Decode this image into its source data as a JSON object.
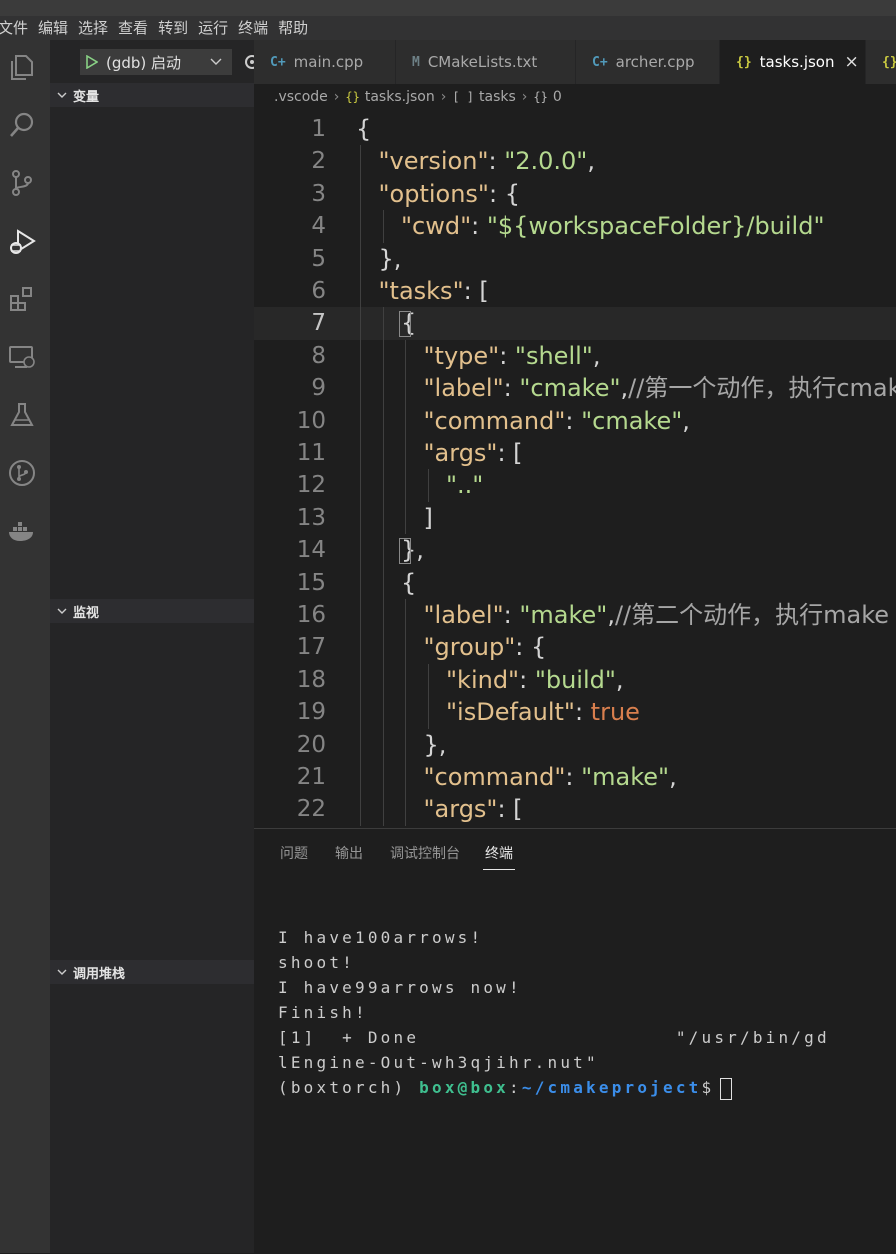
{
  "menu": [
    "文件",
    "编辑",
    "选择",
    "查看",
    "转到",
    "运行",
    "终端",
    "帮助"
  ],
  "activity_icons": [
    "files-icon",
    "search-icon",
    "source-control-icon",
    "run-debug-icon",
    "extensions-icon",
    "remote-explorer-icon",
    "testing-icon",
    "git-graph-icon",
    "docker-icon"
  ],
  "debug": {
    "launch_config": "(gdb) 启动"
  },
  "sidebar": {
    "sections": [
      {
        "title": "变量"
      },
      {
        "title": "监视"
      },
      {
        "title": "调用堆栈"
      }
    ]
  },
  "tabs": [
    {
      "icon": "C+",
      "label": "main.cpp",
      "color": "#519aba"
    },
    {
      "icon": "M",
      "label": "CMakeLists.txt",
      "color": "#6d8086"
    },
    {
      "icon": "C+",
      "label": "archer.cpp",
      "color": "#519aba"
    },
    {
      "icon": "{}",
      "label": "tasks.json",
      "color": "#cbcb41",
      "active": true,
      "close": "×"
    },
    {
      "icon": "{}",
      "label": "",
      "color": "#cbcb41"
    }
  ],
  "breadcrumb": {
    "folder": ".vscode",
    "file": "tasks.json",
    "node1": "tasks",
    "node2": "0",
    "icon_json": "{}",
    "icon_array": "[ ]",
    "icon_obj": "{}"
  },
  "editor": {
    "current_line": 7,
    "lines": [
      {
        "n": "1",
        "indent": 0,
        "tokens": [
          [
            "p",
            "{"
          ]
        ]
      },
      {
        "n": "2",
        "indent": 1,
        "tokens": [
          [
            "k",
            "\"version\""
          ],
          [
            "p",
            ": "
          ],
          [
            "s",
            "\"2.0.0\""
          ],
          [
            "p",
            ","
          ]
        ]
      },
      {
        "n": "3",
        "indent": 1,
        "tokens": [
          [
            "k",
            "\"options\""
          ],
          [
            "p",
            ": {"
          ]
        ]
      },
      {
        "n": "4",
        "indent": 2,
        "tokens": [
          [
            "k",
            "\"cwd\""
          ],
          [
            "p",
            ": "
          ],
          [
            "s",
            "\"${workspaceFolder}/build\""
          ]
        ]
      },
      {
        "n": "5",
        "indent": 1,
        "tokens": [
          [
            "p",
            "},"
          ]
        ]
      },
      {
        "n": "6",
        "indent": 1,
        "tokens": [
          [
            "k",
            "\"tasks\""
          ],
          [
            "p",
            ": ["
          ]
        ]
      },
      {
        "n": "7",
        "indent": 2,
        "tokens": [
          [
            "p",
            "{"
          ]
        ]
      },
      {
        "n": "8",
        "indent": 3,
        "tokens": [
          [
            "k",
            "\"type\""
          ],
          [
            "p",
            ": "
          ],
          [
            "s",
            "\"shell\""
          ],
          [
            "p",
            ","
          ]
        ]
      },
      {
        "n": "9",
        "indent": 3,
        "tokens": [
          [
            "k",
            "\"label\""
          ],
          [
            "p",
            ": "
          ],
          [
            "s",
            "\"cmake\""
          ],
          [
            "p",
            ","
          ],
          [
            "c",
            "//第一个动作，执行cmake"
          ]
        ]
      },
      {
        "n": "10",
        "indent": 3,
        "tokens": [
          [
            "k",
            "\"command\""
          ],
          [
            "p",
            ": "
          ],
          [
            "s",
            "\"cmake\""
          ],
          [
            "p",
            ","
          ]
        ]
      },
      {
        "n": "11",
        "indent": 3,
        "tokens": [
          [
            "k",
            "\"args\""
          ],
          [
            "p",
            ": ["
          ]
        ]
      },
      {
        "n": "12",
        "indent": 4,
        "tokens": [
          [
            "s",
            "\"..\""
          ]
        ]
      },
      {
        "n": "13",
        "indent": 3,
        "tokens": [
          [
            "p",
            "]"
          ]
        ]
      },
      {
        "n": "14",
        "indent": 2,
        "tokens": [
          [
            "p",
            "},"
          ]
        ]
      },
      {
        "n": "15",
        "indent": 2,
        "tokens": [
          [
            "p",
            "{"
          ]
        ]
      },
      {
        "n": "16",
        "indent": 3,
        "tokens": [
          [
            "k",
            "\"label\""
          ],
          [
            "p",
            ": "
          ],
          [
            "s",
            "\"make\""
          ],
          [
            "p",
            ","
          ],
          [
            "c",
            "//第二个动作，执行make"
          ]
        ]
      },
      {
        "n": "17",
        "indent": 3,
        "tokens": [
          [
            "k",
            "\"group\""
          ],
          [
            "p",
            ": {"
          ]
        ]
      },
      {
        "n": "18",
        "indent": 4,
        "tokens": [
          [
            "k",
            "\"kind\""
          ],
          [
            "p",
            ": "
          ],
          [
            "s",
            "\"build\""
          ],
          [
            "p",
            ","
          ]
        ]
      },
      {
        "n": "19",
        "indent": 4,
        "tokens": [
          [
            "k",
            "\"isDefault\""
          ],
          [
            "p",
            ": "
          ],
          [
            "b",
            "true"
          ]
        ]
      },
      {
        "n": "20",
        "indent": 3,
        "tokens": [
          [
            "p",
            "},"
          ]
        ]
      },
      {
        "n": "21",
        "indent": 3,
        "tokens": [
          [
            "k",
            "\"command\""
          ],
          [
            "p",
            ": "
          ],
          [
            "s",
            "\"make\""
          ],
          [
            "p",
            ","
          ]
        ]
      },
      {
        "n": "22",
        "indent": 3,
        "tokens": [
          [
            "k",
            "\"args\""
          ],
          [
            "p",
            ": ["
          ]
        ]
      }
    ]
  },
  "panel": {
    "tabs": [
      "问题",
      "输出",
      "调试控制台",
      "终端"
    ],
    "active_tab": "终端",
    "terminal_lines": [
      "I have100arrows!",
      "shoot!",
      "I have99arrows now!",
      "Finish!",
      "[1]  + Done                    \"/usr/bin/gd",
      "lEngine-Out-wh3qjihr.nut\""
    ],
    "prompt": {
      "env": "(boxtorch)",
      "user": "box@box",
      "sep": ":",
      "path": "~/cmakeproject",
      "symbol": "$"
    }
  }
}
